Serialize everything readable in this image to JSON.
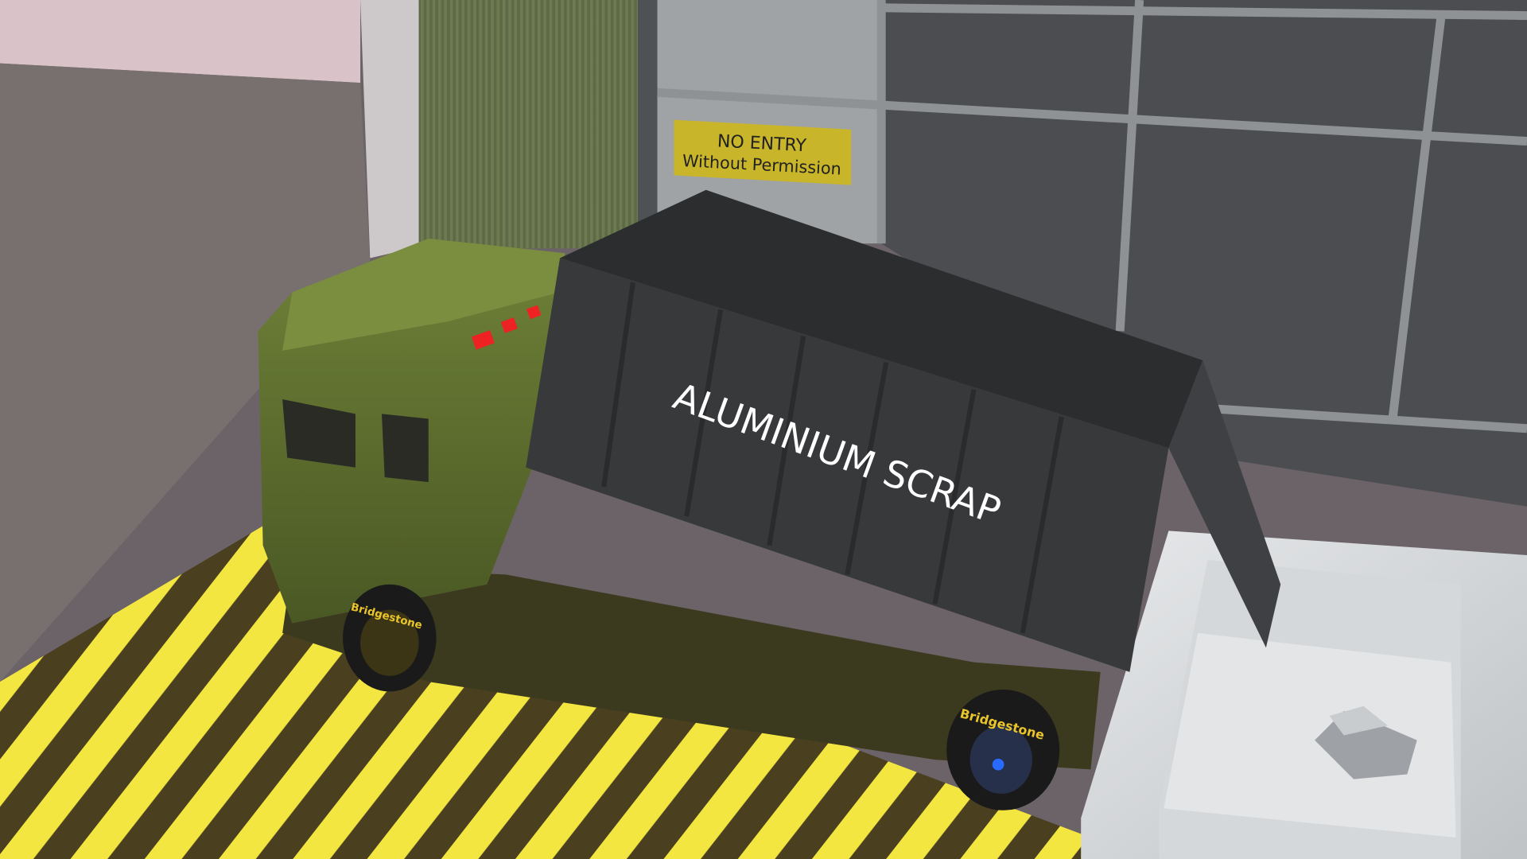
{
  "sign": {
    "line1": "NO ENTRY",
    "line2": "Without Permission",
    "color": "#c9b52a"
  },
  "truck": {
    "bed_label": "ALUMINIUM SCRAP",
    "tire_brand": "Bridgestone",
    "cab_color": "#5f7030",
    "bed_color": "#38393b"
  },
  "floor": {
    "stripe_color": "#f2e23a"
  }
}
